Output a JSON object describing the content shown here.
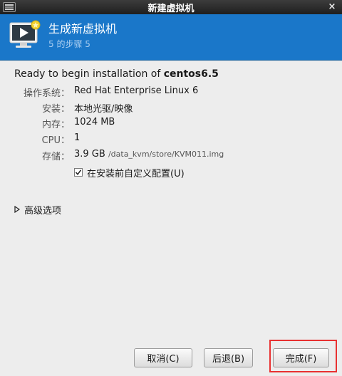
{
  "titlebar": {
    "title": "新建虚拟机",
    "close_glyph": "×",
    "menu_icon": "window-menu-icon"
  },
  "header": {
    "icon": "virtual-machine-monitor-icon",
    "title": "生成新虚拟机",
    "step": "5 的步骤 5"
  },
  "summary": {
    "ready_prefix": "Ready to begin installation of ",
    "vm_name": "centos6.5",
    "rows": [
      {
        "label": "操作系统：",
        "value": "Red Hat Enterprise Linux 6"
      },
      {
        "label": "安装：",
        "value": "本地光驱/映像"
      },
      {
        "label": "内存：",
        "value": "1024 MB"
      },
      {
        "label": "CPU：",
        "value": "1"
      },
      {
        "label": "存储：",
        "value": "3.9 GB",
        "path": "/data_kvm/store/KVM011.img"
      }
    ],
    "customize": {
      "label": "在安装前自定义配置(U)",
      "checked": true
    }
  },
  "advanced": {
    "label": "高级选项",
    "expanded": false
  },
  "buttons": {
    "cancel": "取消(C)",
    "back": "后退(B)",
    "finish": "完成(F)"
  },
  "colors": {
    "header_bg": "#1a77c9",
    "titlebar_bg": "#2a2a2a",
    "highlight": "#e83131"
  }
}
